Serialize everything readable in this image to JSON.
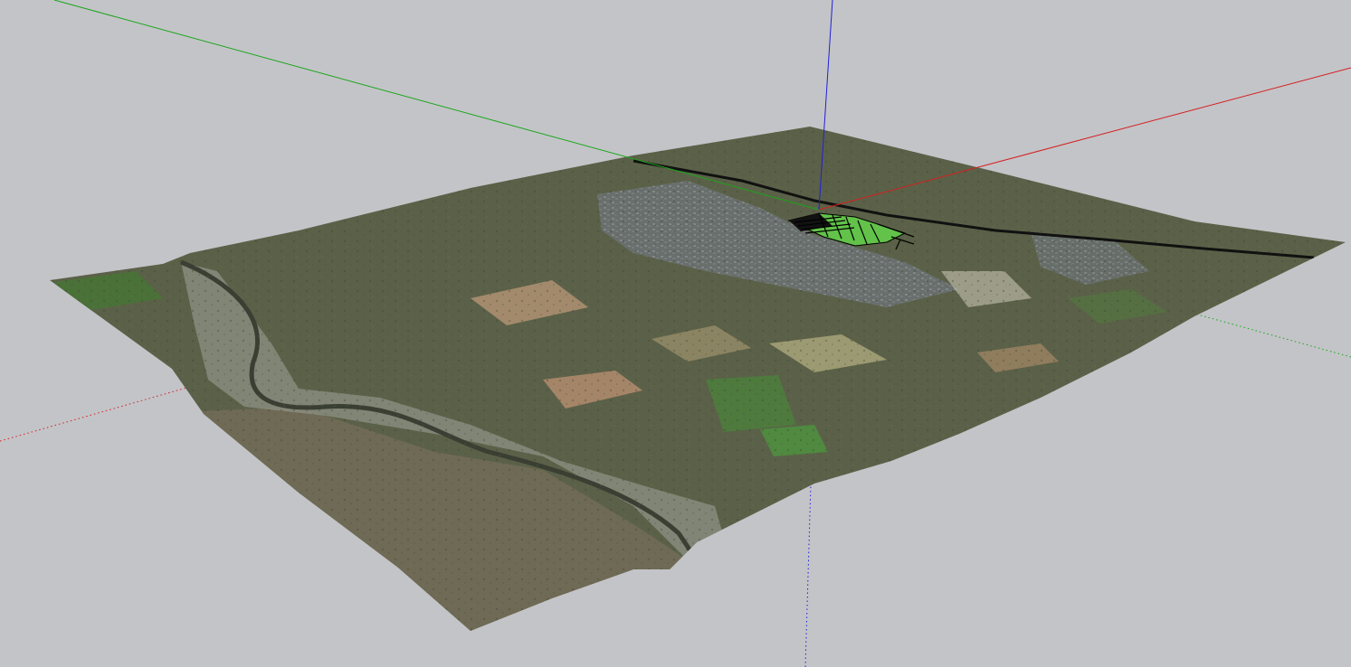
{
  "viewport": {
    "background": "#c3c4c8",
    "axis_colors": {
      "red": "#d42020",
      "green": "#1aa61a",
      "blue": "#2020d6"
    }
  },
  "terrain": {
    "colors": {
      "base": "#5b6148",
      "field_green": "#4e7a3e",
      "field_tan": "#a38a6c",
      "urban": "#6e7478",
      "canyon_rock": "#8d9185",
      "river": "#3a3f33",
      "road": "#111111",
      "model_fill": "#62c24a"
    }
  }
}
